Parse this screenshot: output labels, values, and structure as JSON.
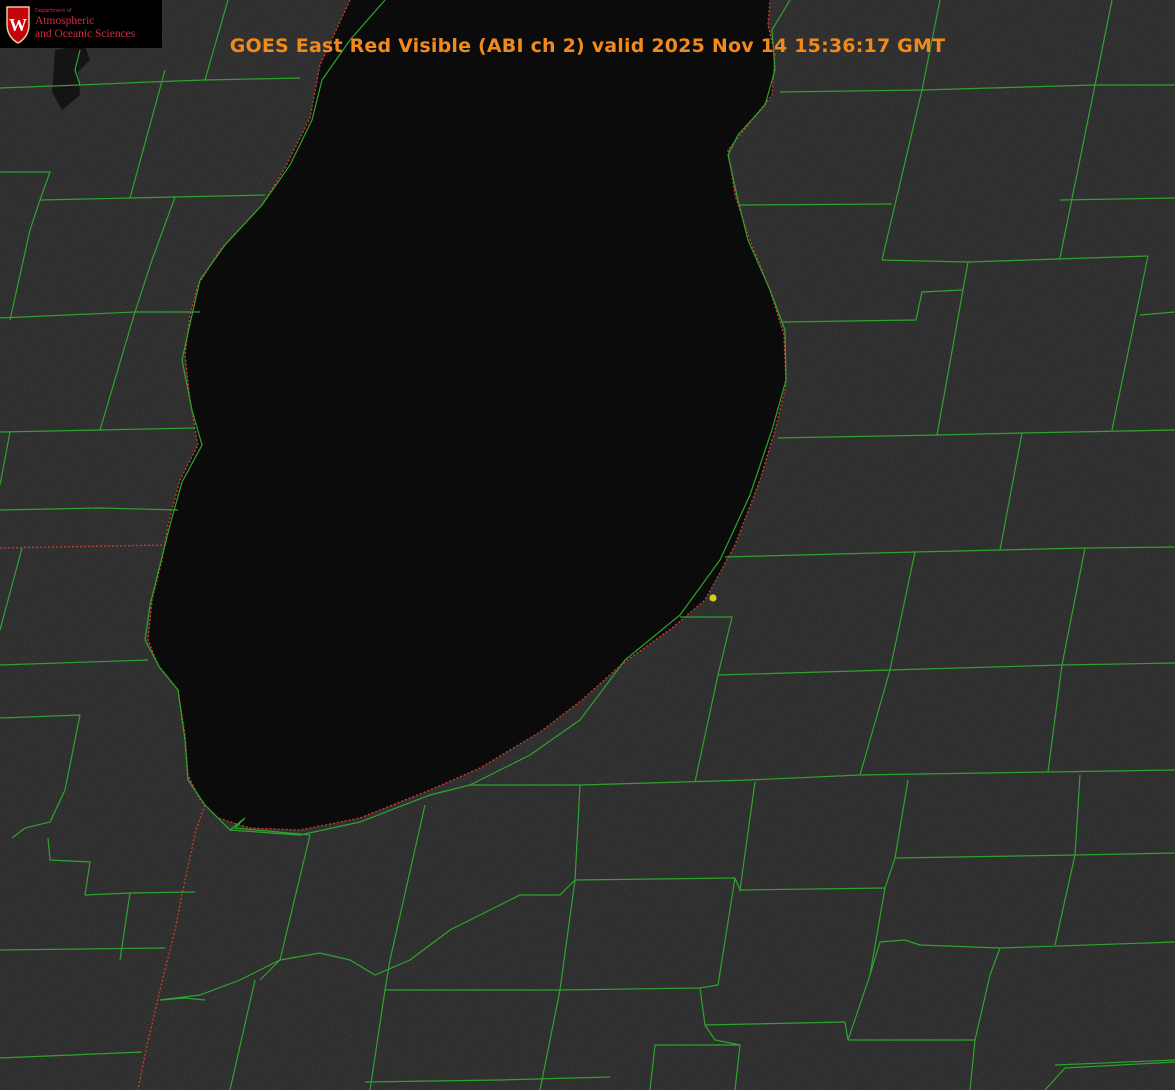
{
  "title": {
    "text": "GOES East Red Visible (ABI ch 2) valid 2025 Nov 14 15:36:17 GMT",
    "color": "#f08a1e"
  },
  "logo": {
    "dept_text": "Department of",
    "line1": "Atmospheric",
    "line2": "and Oceanic Sciences",
    "crest_letter": "W",
    "text_color": "#d12c3e",
    "crest_color": "#c5050c"
  },
  "colors": {
    "land": "#232323",
    "lake": "#0b0b0b",
    "county_border": "#2fa32f",
    "state_border": "#d23a2a",
    "marker": "#d6cf1c"
  },
  "icons": {
    "crest": "uw-crest-icon",
    "marker": "location-dot-icon"
  }
}
